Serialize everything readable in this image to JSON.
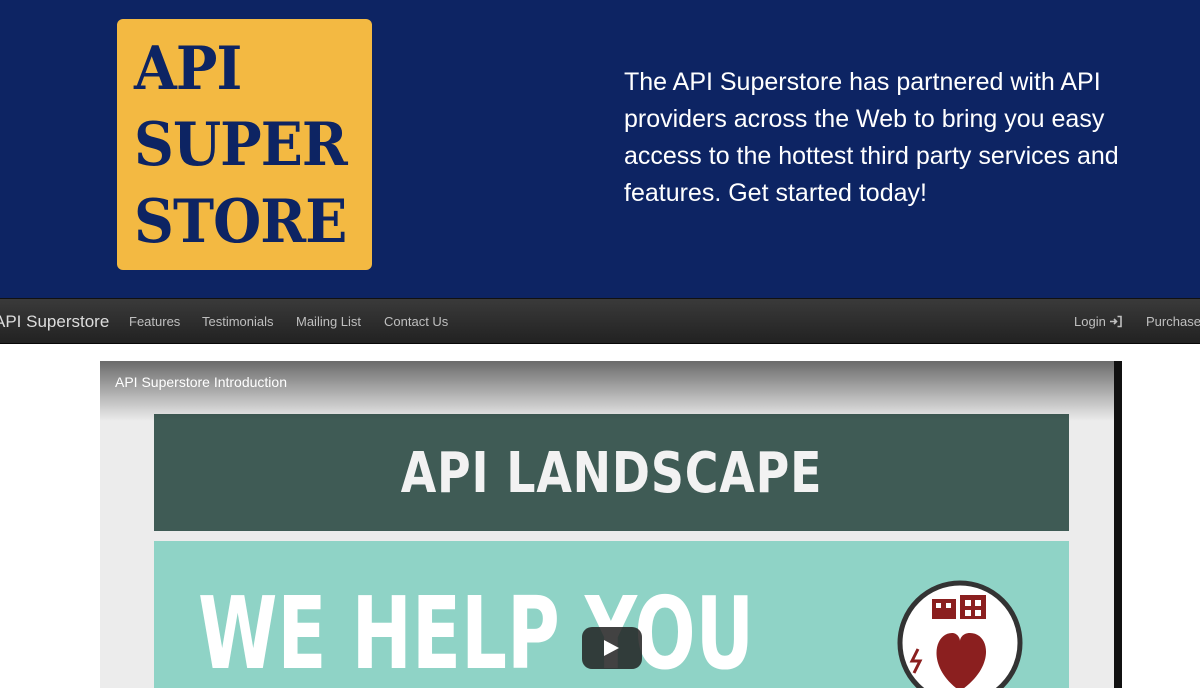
{
  "header": {
    "logo": {
      "line1": "API",
      "line2": "SUPER",
      "line3": "STORE"
    },
    "tagline": "The API Superstore has partnered with API providers across the Web to bring you easy access to the hottest third party services and features. Get started today!"
  },
  "navbar": {
    "brand": "API Superstore",
    "links": [
      "Features",
      "Testimonials",
      "Mailing List",
      "Contact Us"
    ],
    "login": "Login",
    "purchase": "Purchase",
    "login_icon": "sign-in-icon"
  },
  "video": {
    "title": "API Superstore Introduction",
    "slide_heading": "API LANDSCAPE",
    "slide_text": "WE HELP YOU",
    "badge_icon": "heart-building-icon",
    "play_icon": "play-icon"
  },
  "colors": {
    "header_bg": "#0d2463",
    "logo_bg": "#f3b942",
    "slide_heading_bg": "#3f5b55",
    "slide_body_bg": "#8fd3c6",
    "heart": "#8b1f1f"
  }
}
